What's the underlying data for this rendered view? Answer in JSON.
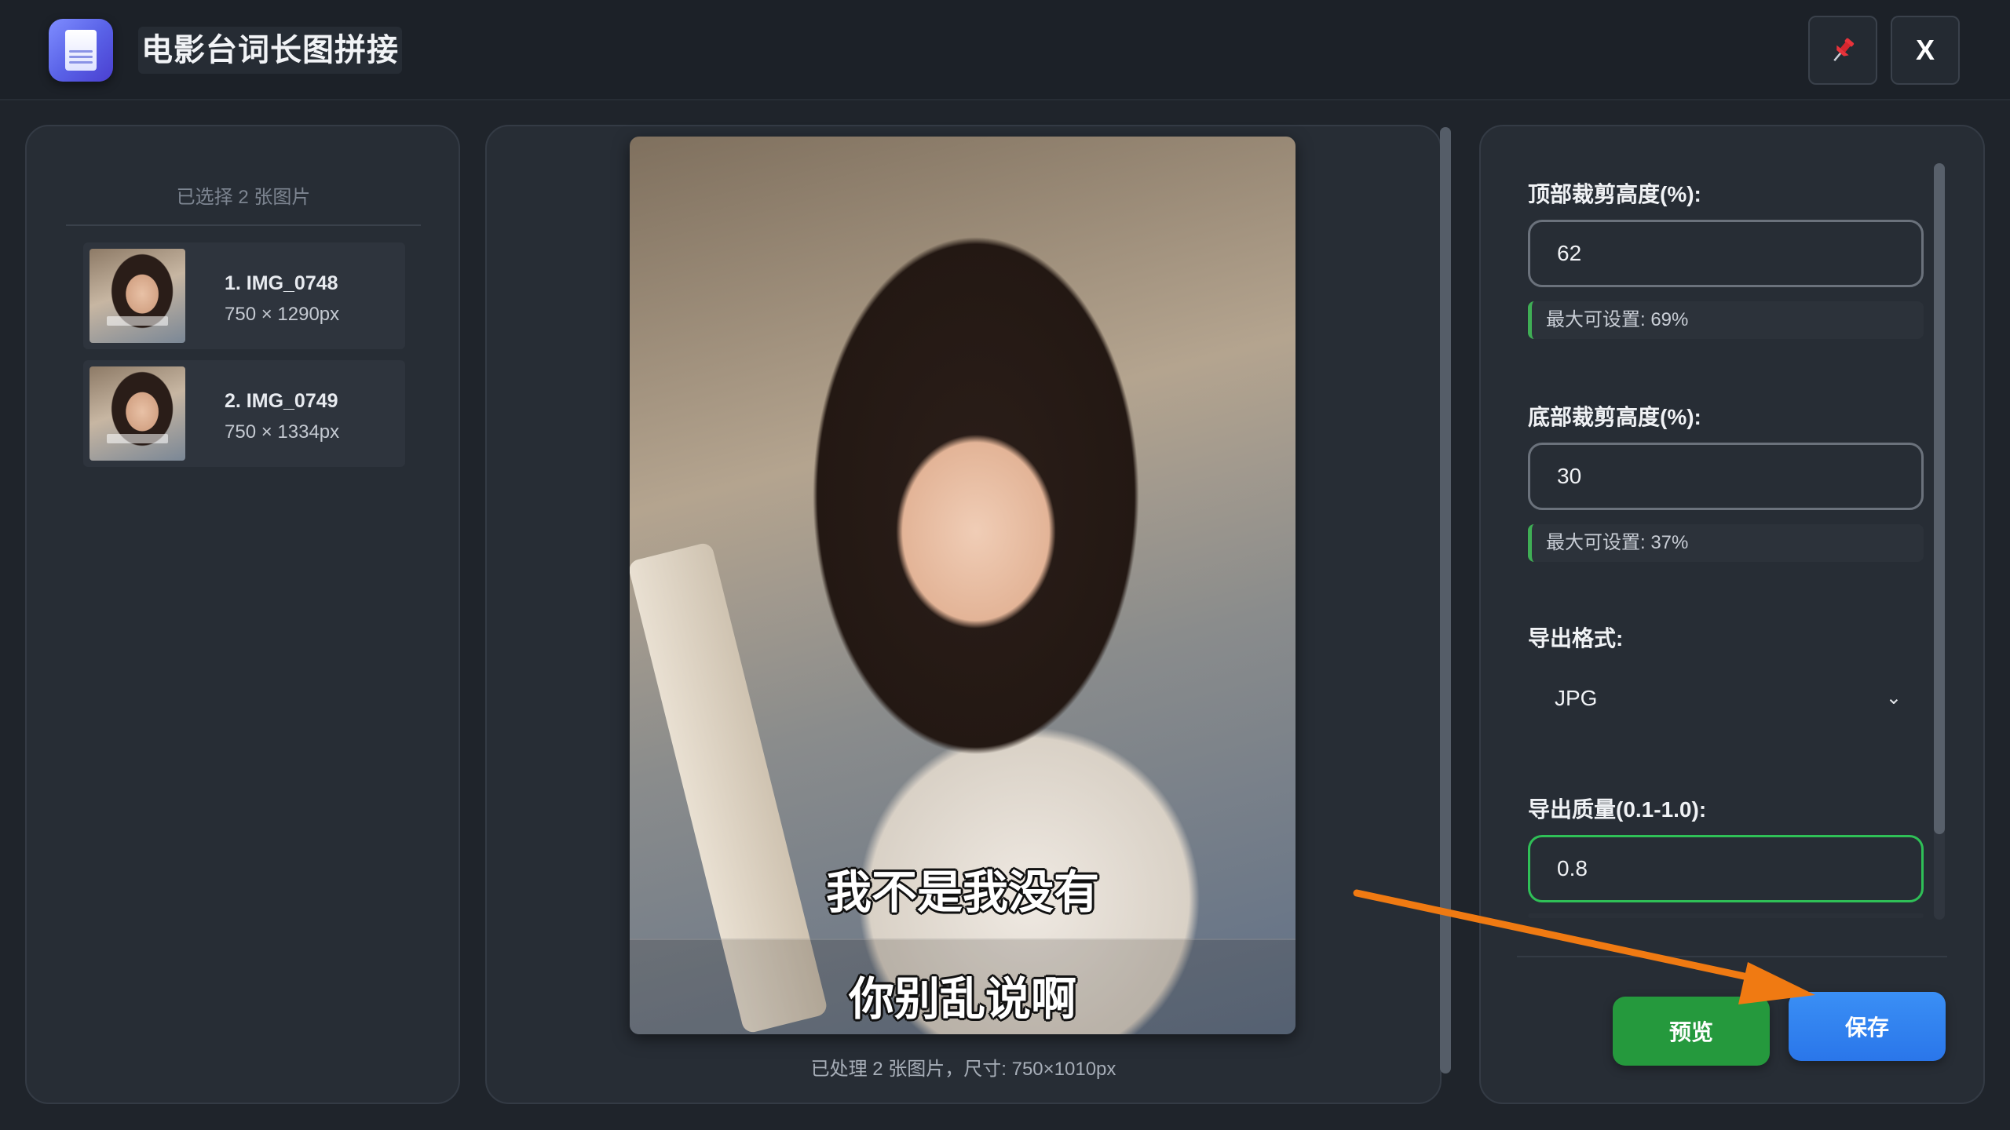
{
  "window": {
    "title": "电影台词长图拼接",
    "icons": {
      "app": "layers-icon",
      "pin": "pin-icon"
    },
    "close_label": "X"
  },
  "left_panel": {
    "selected_count_text": "已选择 2 张图片",
    "files": [
      {
        "name": "1. IMG_0748",
        "size": "750 × 1290px"
      },
      {
        "name": "2. IMG_0749",
        "size": "750 × 1334px"
      }
    ]
  },
  "preview": {
    "captions": [
      "我不是我没有",
      "你别乱说啊"
    ],
    "status": "已处理 2 张图片，尺寸: 750×1010px"
  },
  "settings": {
    "top_crop": {
      "label": "顶部裁剪高度(%):",
      "value": "62",
      "hint": "最大可设置: 69%"
    },
    "bottom_crop": {
      "label": "底部裁剪高度(%):",
      "value": "30",
      "hint": "最大可设置: 37%"
    },
    "format": {
      "label": "导出格式:",
      "value": "JPG"
    },
    "quality": {
      "label": "导出质量(0.1-1.0):",
      "value": "0.8"
    }
  },
  "actions": {
    "preview_label": "预览",
    "save_label": "保存"
  },
  "colors": {
    "accent_blue": "#2a7de9",
    "accent_green": "#25993d",
    "annotation_arrow": "#f07a12"
  }
}
